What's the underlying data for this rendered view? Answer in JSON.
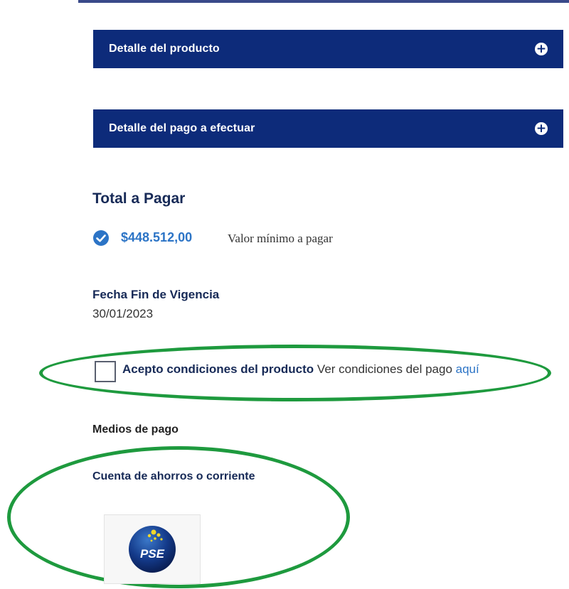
{
  "accordions": [
    {
      "title": "Detalle del producto"
    },
    {
      "title": "Detalle del pago a efectuar"
    }
  ],
  "total": {
    "title": "Total a Pagar",
    "amount": "$448.512,00",
    "description": "Valor mínimo a pagar"
  },
  "vigencia": {
    "label": "Fecha Fin de Vigencia",
    "value": "30/01/2023"
  },
  "terms": {
    "accept_label": "Acepto condiciones del producto",
    "text": "Ver condiciones del pago",
    "link": "aquí",
    "checked": false
  },
  "payment": {
    "title": "Medios de pago",
    "method_label": "Cuenta de ahorros o corriente",
    "logo_text": "PSE"
  },
  "colors": {
    "header_blue": "#0d2b7a",
    "accent_blue": "#2c74c6",
    "highlight_green": "#1e9a3e"
  },
  "icons": {
    "accordion_toggle": "plus-circle-icon",
    "selected_amount": "check-circle-icon",
    "payment_logo": "pse-logo-icon"
  }
}
